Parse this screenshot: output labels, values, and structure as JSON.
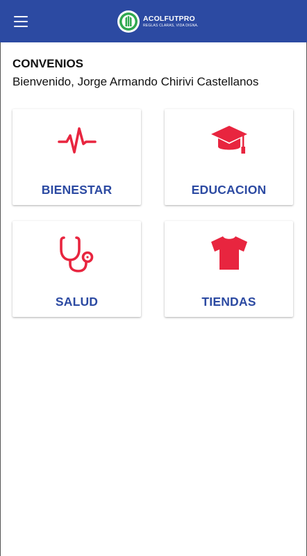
{
  "header": {
    "brand_name": "ACOLFUTPRO",
    "brand_tagline": "REGLAS CLARAS, VIDA DIGNA."
  },
  "page": {
    "title": "CONVENIOS",
    "welcome": "Bienvenido, Jorge Armando Chirivi Castellanos"
  },
  "cards": [
    {
      "label": "BIENESTAR",
      "icon": "heartbeat-icon"
    },
    {
      "label": "EDUCACION",
      "icon": "graduation-cap-icon"
    },
    {
      "label": "SALUD",
      "icon": "stethoscope-icon"
    },
    {
      "label": "TIENDAS",
      "icon": "tshirt-icon"
    }
  ],
  "colors": {
    "primary": "#2c4aa2",
    "accent": "#e8253f",
    "card_label": "#2c4aa2"
  }
}
